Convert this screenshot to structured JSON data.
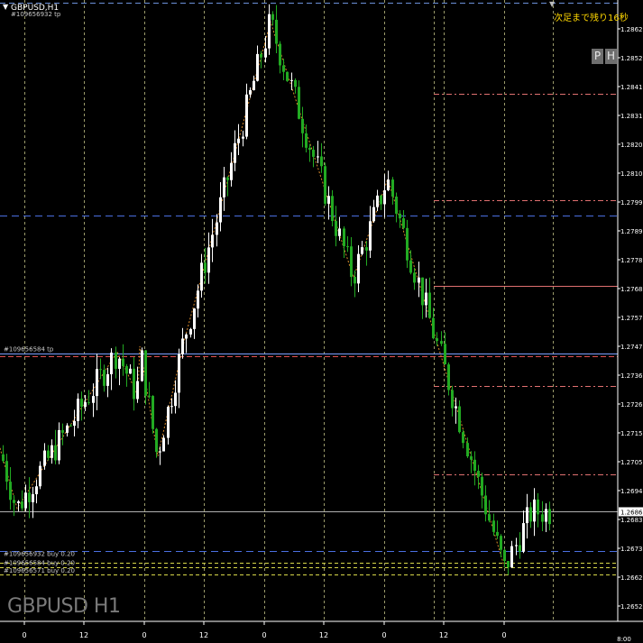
{
  "header": {
    "symbol_label": "GBPUSD,H1",
    "order_tag": "#109656932 tp",
    "countdown": "次足まで残り16秒"
  },
  "watermark": "GBPUSD H1",
  "panel_buttons": [
    {
      "label": "P"
    },
    {
      "label": "H"
    }
  ],
  "price_axis": {
    "ticks": [
      "1.28625",
      "1.28520",
      "1.28415",
      "1.28310",
      "1.28205",
      "1.28100",
      "1.27995",
      "1.27890",
      "1.27785",
      "1.27680",
      "1.27575",
      "1.27470",
      "1.27365",
      "1.27260",
      "1.27155",
      "1.27050",
      "1.26945",
      "1.26835",
      "1.26730",
      "1.26625",
      "1.26520"
    ],
    "current_price": "1.26868",
    "bottom_label": "1.26520"
  },
  "time_axis": {
    "ticks": [
      "0",
      "12",
      "0",
      "12",
      "0",
      "12",
      "0",
      "12",
      "0"
    ],
    "time_marker": "8:00"
  },
  "order_labels": [
    {
      "text": "#109656584 tp",
      "price": 1.27445,
      "color": "#c8c8c8"
    },
    {
      "text": "#109656932 buy 0.20",
      "price": 1.267,
      "color": "#c8c8c8"
    },
    {
      "text": "#109656584 buy 0.20",
      "price": 1.26668,
      "color": "#c8c8c8"
    },
    {
      "text": "#109656571 buy 0.20",
      "price": 1.2664,
      "color": "#c8c8c8"
    }
  ],
  "hlines": [
    {
      "price": 1.2872,
      "color": "#6b8fd8",
      "dash": "6,4",
      "from": "all"
    },
    {
      "price": 1.27945,
      "color": "#4a6fe0",
      "dash": "8,5",
      "from": "all"
    },
    {
      "price": 1.27445,
      "color": "#7aa0ff",
      "dash": "",
      "from": "all"
    },
    {
      "price": 1.27435,
      "color": "#e05050",
      "dash": "6,3",
      "from": "all"
    },
    {
      "price": 1.26868,
      "color": "#b0b0b0",
      "dash": "",
      "from": "all"
    },
    {
      "price": 1.26725,
      "color": "#4a6fe0",
      "dash": "8,5",
      "from": "all"
    },
    {
      "price": 1.26682,
      "color": "#d8d84a",
      "dash": "4,3",
      "from": "all"
    },
    {
      "price": 1.26665,
      "color": "#d8d84a",
      "dash": "4,3",
      "from": "all"
    },
    {
      "price": 1.2664,
      "color": "#d8d84a",
      "dash": "4,3",
      "from": "all"
    },
    {
      "price": 1.2874,
      "color": "#e07070",
      "dash": "6,3,2,3",
      "from": "right"
    },
    {
      "price": 1.2839,
      "color": "#e07070",
      "dash": "6,3,2,3",
      "from": "right"
    },
    {
      "price": 1.28,
      "color": "#e07070",
      "dash": "6,3,2,3",
      "from": "right"
    },
    {
      "price": 1.2769,
      "color": "#e07070",
      "dash": "",
      "from": "right"
    },
    {
      "price": 1.27325,
      "color": "#e07070",
      "dash": "6,3,2,3",
      "from": "right"
    },
    {
      "price": 1.27005,
      "color": "#e07070",
      "dash": "6,3,2,3",
      "from": "right"
    }
  ],
  "zigzag": [
    [
      0,
      1.271
    ],
    [
      19,
      1.2688
    ],
    [
      130,
      1.2745
    ],
    [
      153,
      1.2729
    ],
    [
      155,
      1.2747
    ],
    [
      175,
      1.2707
    ],
    [
      205,
      1.275
    ],
    [
      300,
      1.2865
    ],
    [
      392,
      1.2772
    ],
    [
      430,
      1.2808
    ],
    [
      560,
      1.2666
    ]
  ],
  "colors": {
    "bull": "#ffffff",
    "bear": "#22aa22",
    "grid": "#9a9a6a",
    "axis": "#ffffff",
    "zigzag": "#d98a2a",
    "countdown": "#ffd700"
  }
}
